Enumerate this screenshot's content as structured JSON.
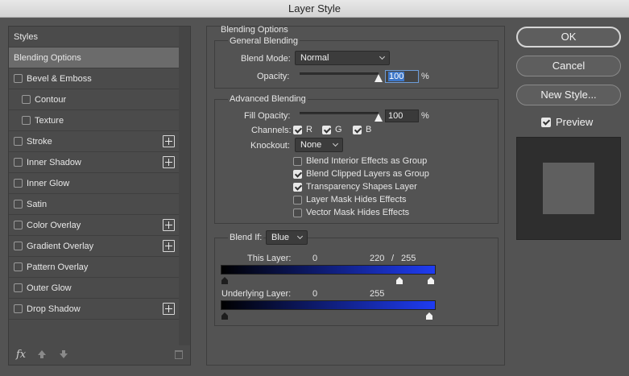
{
  "window": {
    "title": "Layer Style"
  },
  "styles_list": {
    "header": "Styles",
    "items": [
      {
        "label": "Blending Options",
        "selected": true,
        "checkbox": false,
        "plus": false,
        "indent": false
      },
      {
        "label": "Bevel & Emboss",
        "checkbox": true,
        "checked": false,
        "plus": false,
        "indent": false
      },
      {
        "label": "Contour",
        "checkbox": true,
        "checked": false,
        "plus": false,
        "indent": true
      },
      {
        "label": "Texture",
        "checkbox": true,
        "checked": false,
        "plus": false,
        "indent": true
      },
      {
        "label": "Stroke",
        "checkbox": true,
        "checked": false,
        "plus": true,
        "indent": false
      },
      {
        "label": "Inner Shadow",
        "checkbox": true,
        "checked": false,
        "plus": true,
        "indent": false
      },
      {
        "label": "Inner Glow",
        "checkbox": true,
        "checked": false,
        "plus": false,
        "indent": false
      },
      {
        "label": "Satin",
        "checkbox": true,
        "checked": false,
        "plus": false,
        "indent": false
      },
      {
        "label": "Color Overlay",
        "checkbox": true,
        "checked": false,
        "plus": true,
        "indent": false
      },
      {
        "label": "Gradient Overlay",
        "checkbox": true,
        "checked": false,
        "plus": true,
        "indent": false
      },
      {
        "label": "Pattern Overlay",
        "checkbox": true,
        "checked": false,
        "plus": false,
        "indent": false
      },
      {
        "label": "Outer Glow",
        "checkbox": true,
        "checked": false,
        "plus": false,
        "indent": false
      },
      {
        "label": "Drop Shadow",
        "checkbox": true,
        "checked": false,
        "plus": true,
        "indent": false
      }
    ],
    "footer": {
      "fx_label": "fx"
    }
  },
  "blending": {
    "section_title": "Blending Options",
    "general": {
      "title": "General Blending",
      "blend_mode_label": "Blend Mode:",
      "blend_mode_value": "Normal",
      "opacity_label": "Opacity:",
      "opacity_value": "100",
      "opacity_level": 1.0,
      "percent": "%"
    },
    "advanced": {
      "title": "Advanced Blending",
      "fill_opacity_label": "Fill Opacity:",
      "fill_opacity_value": "100",
      "fill_opacity_level": 1.0,
      "percent": "%",
      "channels_label": "Channels:",
      "channels": [
        {
          "label": "R",
          "checked": true
        },
        {
          "label": "G",
          "checked": true
        },
        {
          "label": "B",
          "checked": true
        }
      ],
      "knockout_label": "Knockout:",
      "knockout_value": "None",
      "options": [
        {
          "label": "Blend Interior Effects as Group",
          "checked": false
        },
        {
          "label": "Blend Clipped Layers as Group",
          "checked": true
        },
        {
          "label": "Transparency Shapes Layer",
          "checked": true
        },
        {
          "label": "Layer Mask Hides Effects",
          "checked": false
        },
        {
          "label": "Vector Mask Hides Effects",
          "checked": false
        }
      ]
    },
    "blend_if": {
      "label": "Blend If:",
      "channel": "Blue",
      "this_layer": {
        "label": "This Layer:",
        "low": "0",
        "high_a": "220",
        "sep": "/",
        "high_b": "255"
      },
      "underlying_layer": {
        "label": "Underlying Layer:",
        "low": "0",
        "high": "255"
      },
      "gradient_colors": [
        "#000000",
        "#1f3cf2"
      ]
    }
  },
  "buttons": {
    "ok": "OK",
    "cancel": "Cancel",
    "new_style": "New Style..."
  },
  "preview": {
    "label": "Preview",
    "checked": true,
    "swatch_color": "#5f5f5f"
  }
}
